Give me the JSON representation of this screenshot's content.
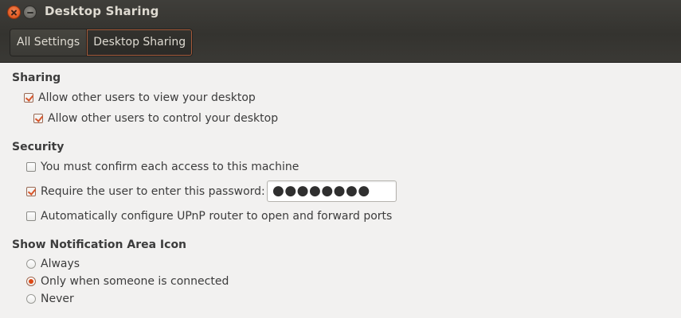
{
  "window": {
    "title": "Desktop Sharing"
  },
  "breadcrumb": {
    "items": [
      "All Settings",
      "Desktop Sharing"
    ]
  },
  "sharing": {
    "title": "Sharing",
    "allow_view": {
      "label": "Allow other users to view your desktop",
      "checked": true
    },
    "allow_control": {
      "label": "Allow other users to control your desktop",
      "checked": true
    }
  },
  "security": {
    "title": "Security",
    "confirm_access": {
      "label": "You must confirm each access to this machine",
      "checked": false
    },
    "require_password": {
      "label": "Require the user to enter this password:",
      "checked": true
    },
    "password_value": "●●●●●●●●",
    "upnp": {
      "label": "Automatically configure UPnP router to open and forward ports",
      "checked": false
    }
  },
  "notification": {
    "title": "Show Notification Area Icon",
    "options": [
      {
        "label": "Always",
        "selected": false
      },
      {
        "label": "Only when someone is connected",
        "selected": true
      },
      {
        "label": "Never",
        "selected": false
      }
    ]
  },
  "colors": {
    "accent": "#dd4814",
    "titlebar": "#3c3b37",
    "content_bg": "#f2f1f0"
  }
}
